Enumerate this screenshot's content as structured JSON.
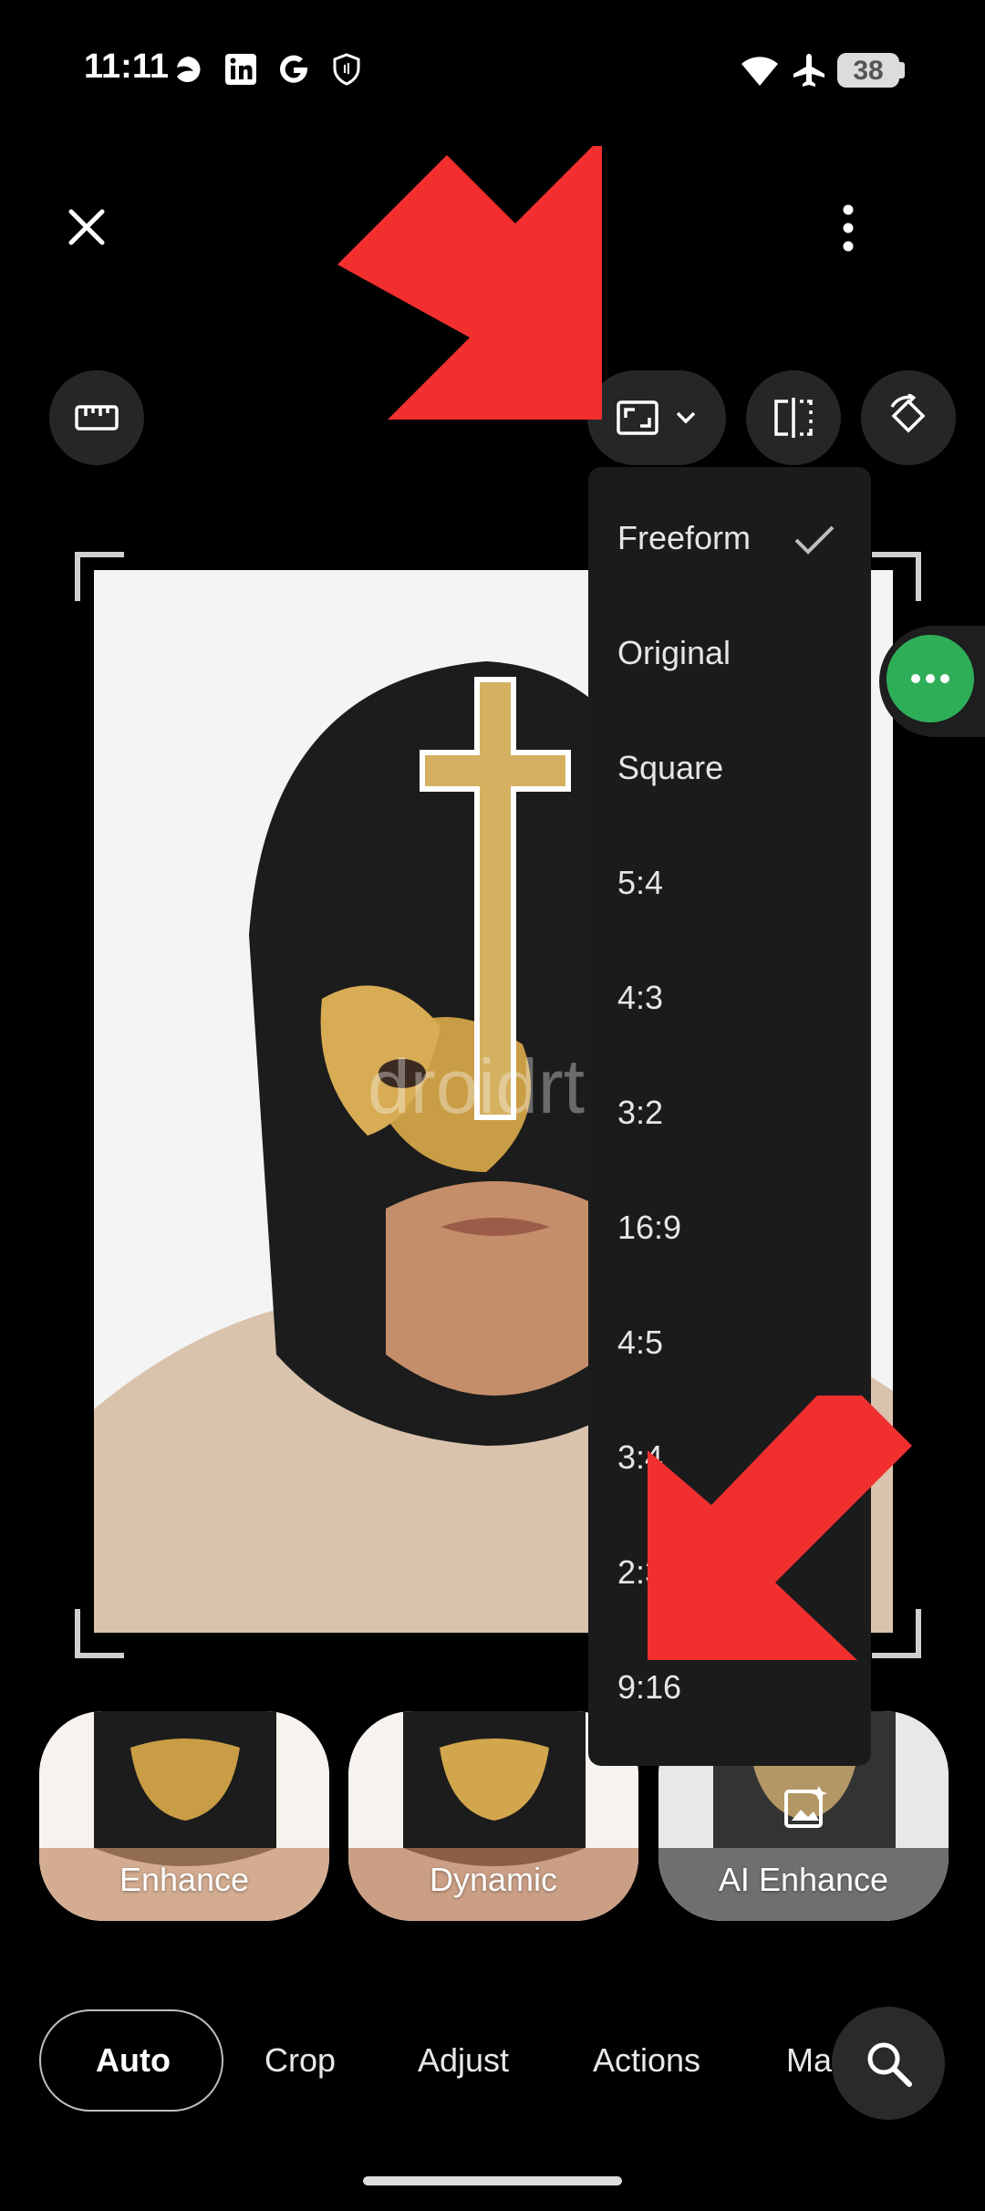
{
  "status_bar": {
    "time": "11:11",
    "battery": "38",
    "left_icons": [
      "edge-icon",
      "linkedin-icon",
      "google-icon",
      "shield-icon"
    ],
    "right_icons": [
      "wifi-icon",
      "airplane-icon",
      "battery-icon"
    ]
  },
  "toolbar": {
    "close_icon": "close-icon",
    "more_icon": "more-vert-icon",
    "tools": [
      "ruler-icon",
      "aspect-ratio-icon",
      "flip-icon",
      "rotate-icon"
    ]
  },
  "aspect_menu": {
    "items": [
      "Freeform",
      "Original",
      "Square",
      "5:4",
      "4:3",
      "3:2",
      "16:9",
      "4:5",
      "3:4",
      "2:3",
      "9:16"
    ],
    "selected": "Freeform"
  },
  "photo": {
    "watermark": "droidrtu"
  },
  "suggestions": [
    "Enhance",
    "Dynamic",
    "AI Enhance"
  ],
  "tabs": [
    "Auto",
    "Crop",
    "Adjust",
    "Actions",
    "Ma"
  ],
  "active_tab": "Auto",
  "colors": {
    "accent_red": "#f22f2f",
    "bubble_green": "#2fae58",
    "menu_bg": "#1b1b1b"
  }
}
